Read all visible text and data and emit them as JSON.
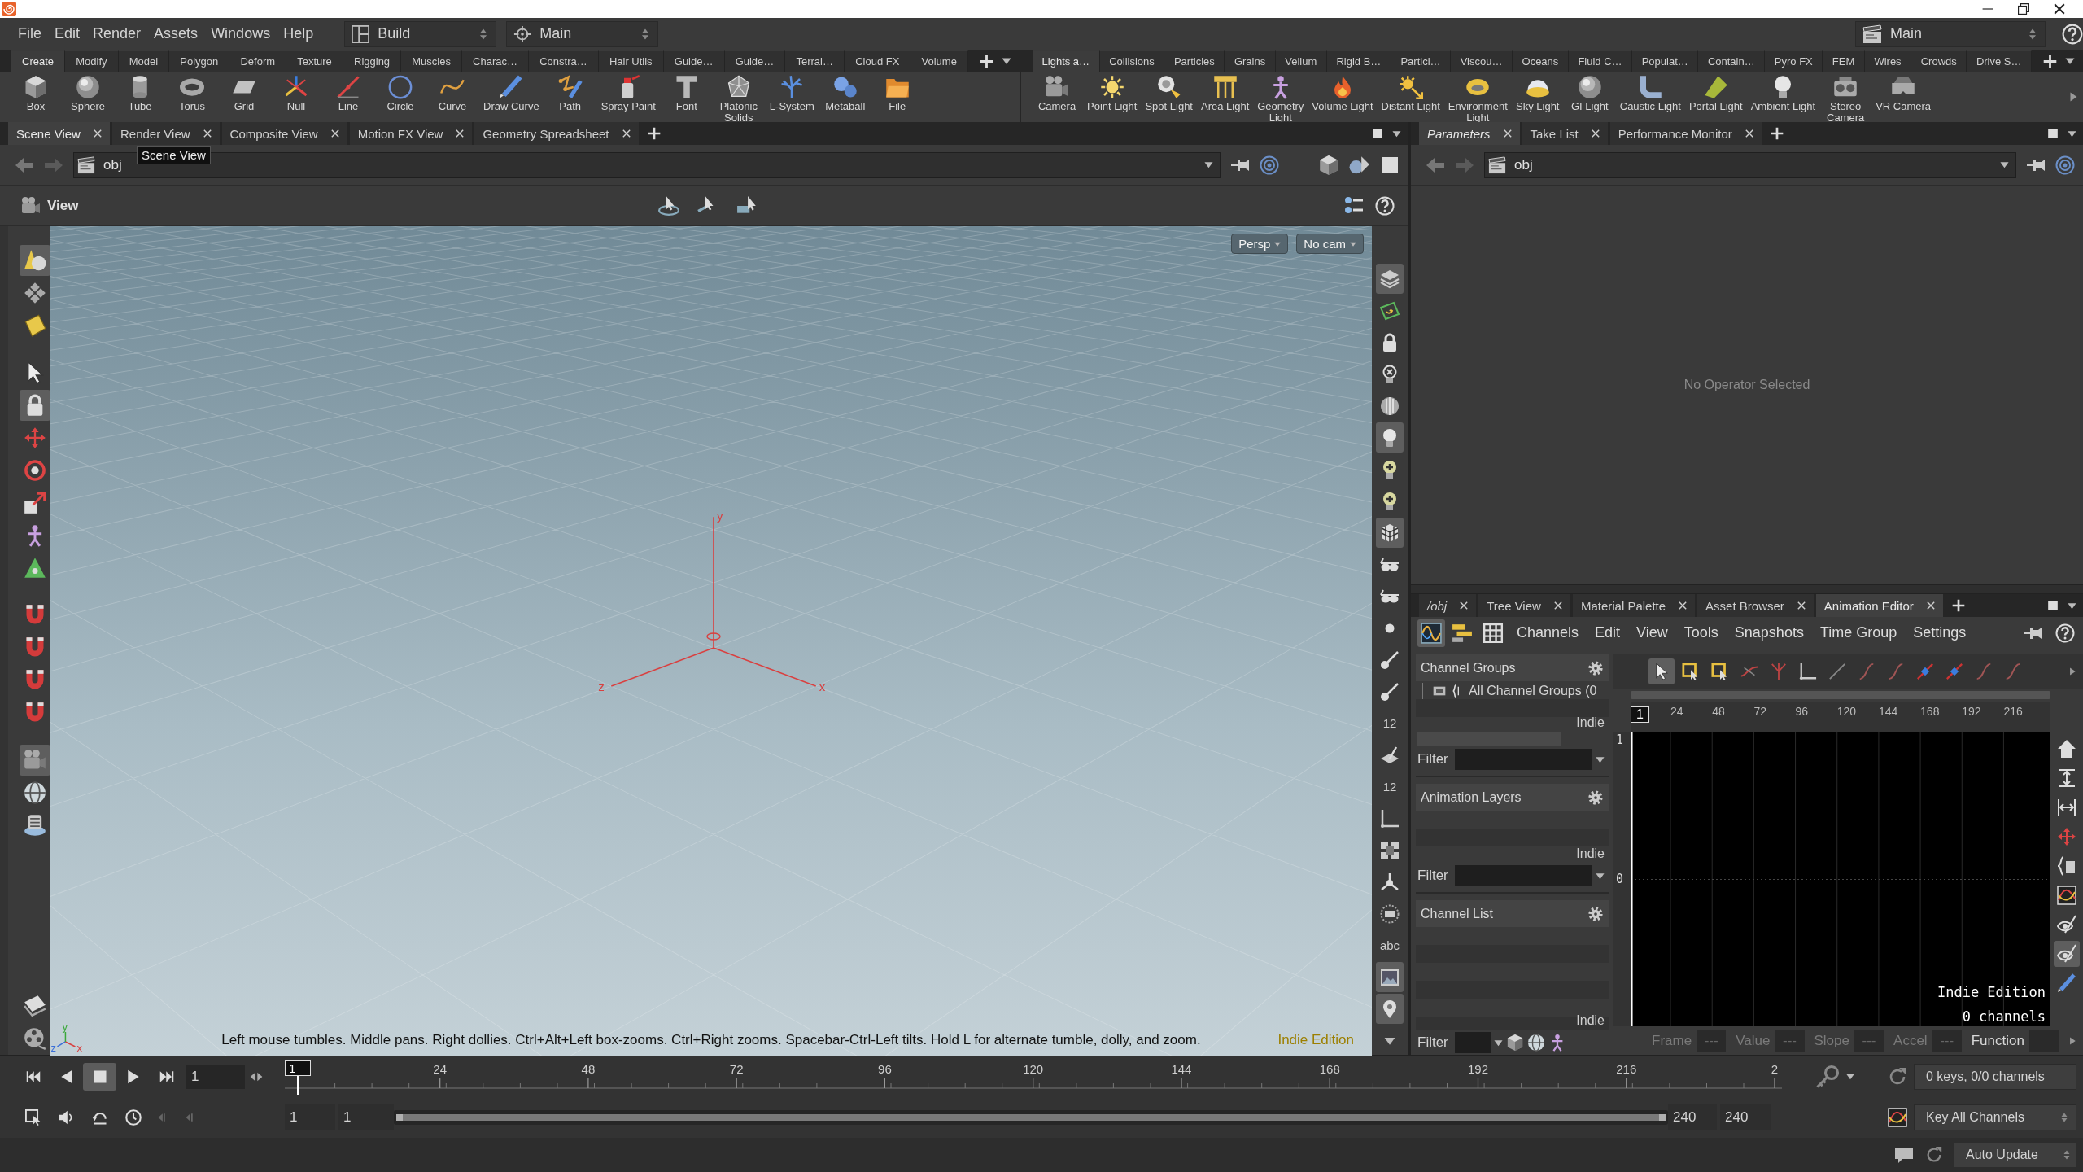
{
  "menu_bar": {
    "items": [
      "File",
      "Edit",
      "Render",
      "Assets",
      "Windows",
      "Help"
    ],
    "desktop": "Build",
    "network": "Main",
    "context": "Main"
  },
  "shelves": [
    {
      "tabs": [
        {
          "label": "Create",
          "selected": true
        },
        {
          "label": "Modify",
          "selected": false
        },
        {
          "label": "Model",
          "selected": false
        },
        {
          "label": "Polygon",
          "selected": false
        },
        {
          "label": "Deform",
          "selected": false
        },
        {
          "label": "Texture",
          "selected": false
        },
        {
          "label": "Rigging",
          "selected": false
        },
        {
          "label": "Muscles",
          "selected": false
        },
        {
          "label": "Charac…",
          "selected": false
        },
        {
          "label": "Constra…",
          "selected": false
        },
        {
          "label": "Hair Utils",
          "selected": false
        },
        {
          "label": "Guide…",
          "selected": false
        },
        {
          "label": "Guide…",
          "selected": false
        },
        {
          "label": "Terrai…",
          "selected": false
        },
        {
          "label": "Cloud FX",
          "selected": false
        },
        {
          "label": "Volume",
          "selected": false
        }
      ],
      "tools": [
        "Box",
        "Sphere",
        "Tube",
        "Torus",
        "Grid",
        "Null",
        "Line",
        "Circle",
        "Curve",
        "Draw Curve",
        "Path",
        "Spray Paint",
        "Font",
        "Platonic\nSolids",
        "L-System",
        "Metaball",
        "File"
      ]
    },
    {
      "tabs": [
        {
          "label": "Lights a…",
          "selected": true
        },
        {
          "label": "Collisions",
          "selected": false
        },
        {
          "label": "Particles",
          "selected": false
        },
        {
          "label": "Grains",
          "selected": false
        },
        {
          "label": "Vellum",
          "selected": false
        },
        {
          "label": "Rigid B…",
          "selected": false
        },
        {
          "label": "Particl…",
          "selected": false
        },
        {
          "label": "Viscou…",
          "selected": false
        },
        {
          "label": "Oceans",
          "selected": false
        },
        {
          "label": "Fluid C…",
          "selected": false
        },
        {
          "label": "Populat…",
          "selected": false
        },
        {
          "label": "Contain…",
          "selected": false
        },
        {
          "label": "Pyro FX",
          "selected": false
        },
        {
          "label": "FEM",
          "selected": false
        },
        {
          "label": "Wires",
          "selected": false
        },
        {
          "label": "Crowds",
          "selected": false
        },
        {
          "label": "Drive S…",
          "selected": false
        }
      ],
      "tools": [
        "Camera",
        "Point Light",
        "Spot Light",
        "Area Light",
        "Geometry\nLight",
        "Volume Light",
        "Distant Light",
        "Environment\nLight",
        "Sky Light",
        "GI Light",
        "Caustic Light",
        "Portal Light",
        "Ambient Light",
        "Stereo\nCamera",
        "VR Camera"
      ]
    }
  ],
  "scene_pane": {
    "tabs": [
      {
        "label": "Scene View",
        "selected": true
      },
      {
        "label": "Render View",
        "selected": false
      },
      {
        "label": "Composite View",
        "selected": false
      },
      {
        "label": "Motion FX View",
        "selected": false
      },
      {
        "label": "Geometry Spreadsheet",
        "selected": false
      }
    ],
    "tooltip": "Scene View",
    "path": "obj",
    "viewer": {
      "title": "View",
      "projection": "Persp",
      "camera": "No cam",
      "axis_labels": [
        "x",
        "y",
        "z"
      ],
      "gizmo_labels": [
        "z",
        "x",
        "y"
      ],
      "hint": "Left mouse tumbles. Middle pans. Right dollies. Ctrl+Alt+Left box-zooms. Ctrl+Right zooms. Spacebar-Ctrl-Left tilts. Hold L for alternate tumble, dolly, and zoom.",
      "edition": "Indie Edition"
    },
    "tools": [
      {
        "selected": true
      },
      {
        "selected": false
      },
      {
        "selected": false
      },
      {
        "selected": false
      },
      {
        "selected": true
      },
      {
        "selected": false
      },
      {
        "selected": false
      },
      {
        "selected": false
      },
      {
        "selected": false
      },
      {
        "selected": false
      },
      {
        "selected": false
      },
      {
        "selected": false
      },
      {
        "selected": false
      },
      {
        "selected": false
      },
      {
        "selected": true
      },
      {
        "selected": false
      },
      {
        "selected": false
      },
      {
        "selected": false
      },
      {
        "selected": false
      }
    ],
    "display_toolbar": [
      {
        "kind": "icon",
        "on": true
      },
      {
        "kind": "icon",
        "on": false
      },
      {
        "kind": "icon",
        "on": false
      },
      {
        "kind": "icon",
        "on": false
      },
      {
        "kind": "icon",
        "on": false
      },
      {
        "kind": "icon",
        "on": true
      },
      {
        "kind": "icon",
        "on": false
      },
      {
        "kind": "icon",
        "on": false
      },
      {
        "kind": "icon",
        "on": true
      },
      {
        "kind": "icon",
        "on": false
      },
      {
        "kind": "icon",
        "on": false
      },
      {
        "kind": "icon",
        "on": false
      },
      {
        "kind": "icon",
        "on": false
      },
      {
        "kind": "icon",
        "on": false
      },
      {
        "kind": "text",
        "label": "12",
        "on": false
      },
      {
        "kind": "icon",
        "on": false
      },
      {
        "kind": "text",
        "label": "12",
        "on": false
      },
      {
        "kind": "icon",
        "on": false
      },
      {
        "kind": "icon",
        "on": false
      },
      {
        "kind": "icon",
        "on": false
      },
      {
        "kind": "icon",
        "on": false
      },
      {
        "kind": "text",
        "label": "abc",
        "on": false
      },
      {
        "kind": "icon",
        "on": true
      },
      {
        "kind": "icon",
        "on": true
      },
      {
        "kind": "icon",
        "on": false
      }
    ]
  },
  "parameters_pane": {
    "tabs": [
      {
        "label": "Parameters",
        "selected": true,
        "italic": true
      },
      {
        "label": "Take List",
        "selected": false,
        "italic": false
      },
      {
        "label": "Performance Monitor",
        "selected": false,
        "italic": false
      }
    ],
    "path": "obj",
    "message": "No Operator Selected"
  },
  "animation_pane": {
    "tabs": [
      {
        "label": "/obj",
        "selected": false,
        "italic": true
      },
      {
        "label": "Tree View",
        "selected": false,
        "italic": false
      },
      {
        "label": "Material Palette",
        "selected": false,
        "italic": false
      },
      {
        "label": "Asset Browser",
        "selected": false,
        "italic": false
      },
      {
        "label": "Animation Editor",
        "selected": true,
        "italic": false
      }
    ],
    "views": [
      {
        "selected": true
      },
      {
        "selected": false
      },
      {
        "selected": false
      }
    ],
    "menu": [
      "Channels",
      "Edit",
      "View",
      "Tools",
      "Snapshots",
      "Time Group",
      "Settings"
    ],
    "sections": [
      {
        "title": "Channel Groups",
        "items": [
          "All Channel Groups (0"
        ],
        "edition": "Indie",
        "filter": "Filter"
      },
      {
        "title": "Animation Layers",
        "edition": "Indie",
        "filter": "Filter"
      },
      {
        "title": "Channel List",
        "edition": "Indie",
        "filter": "Filter"
      }
    ],
    "tools": [
      {
        "selected": true
      },
      {
        "selected": false
      },
      {
        "selected": false
      },
      {
        "selected": false
      },
      {
        "selected": false
      },
      {
        "selected": false
      },
      {
        "selected": false
      },
      {
        "selected": false
      },
      {
        "selected": false
      },
      {
        "selected": false
      },
      {
        "selected": false
      },
      {
        "selected": false
      },
      {
        "selected": false
      }
    ],
    "side_tools": [
      {
        "on": false
      },
      {
        "on": false
      },
      {
        "on": false
      },
      {
        "on": false
      },
      {
        "on": false
      },
      {
        "on": false
      },
      {
        "on": false
      },
      {
        "on": true
      },
      {
        "on": false
      }
    ],
    "graph": {
      "frame_marker": "1",
      "ticks": [
        "24",
        "48",
        "72",
        "96",
        "120",
        "144",
        "168",
        "192",
        "216"
      ],
      "value_labels": [
        "1",
        "0"
      ],
      "edition": "Indie Edition",
      "channel_count": "0 channels"
    },
    "fields": [
      {
        "label": "Frame",
        "value": "---",
        "disabled": true
      },
      {
        "label": "Value",
        "value": "---",
        "disabled": true
      },
      {
        "label": "Slope",
        "value": "---",
        "disabled": true
      },
      {
        "label": "Accel",
        "value": "---",
        "disabled": true
      },
      {
        "label": "Function",
        "disabled": false
      }
    ]
  },
  "timeline": {
    "playback": [
      {
        "selected": false
      },
      {
        "selected": false
      },
      {
        "selected": true
      },
      {
        "selected": false
      },
      {
        "selected": false
      }
    ],
    "frame": "1",
    "marker": "1",
    "ticks": [
      "24",
      "48",
      "72",
      "96",
      "120",
      "144",
      "168",
      "192",
      "216",
      "2"
    ],
    "start": "1",
    "range_start": "1",
    "range_slider": {
      "level": 1
    },
    "range_end": "240",
    "end": "240",
    "keys": "0 keys, 0/0 channels",
    "key_mode": "Key All Channels"
  },
  "status_bar": {
    "update_mode": "Auto Update"
  }
}
